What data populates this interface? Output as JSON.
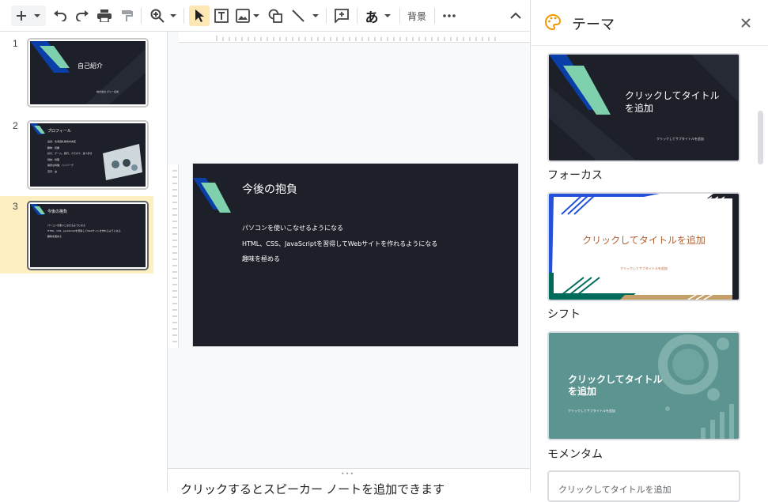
{
  "toolbar": {
    "background_label": "背景",
    "font_char": "あ"
  },
  "filmstrip": {
    "slides": [
      {
        "number": "1",
        "title": "自己紹介",
        "subtitle": "株式会社 ダミー名前"
      },
      {
        "number": "2",
        "title": "プロフィール",
        "lines": [
          "出身：北海道札幌市中央区",
          "趣味：読書",
          "好き：ゲーム、旅行、カラオケ、食べ歩き",
          "特技：料理",
          "得意な料理：ハンバーグ",
          "苦手：虫"
        ]
      },
      {
        "number": "3",
        "title": "今後の抱負",
        "lines": [
          "パソコンを使いこなせるようになる",
          "HTML、CSS、JavaScriptを習得してWebサイトを作れるようになる",
          "趣味を極める"
        ]
      }
    ]
  },
  "canvas": {
    "title": "今後の抱負",
    "lines": [
      "パソコンを使いこなせるようになる",
      "HTML、CSS、JavaScriptを習得してWebサイトを作れるようになる",
      "趣味を極める"
    ]
  },
  "notes": {
    "placeholder": "クリックするとスピーカー ノートを追加できます"
  },
  "themes": {
    "title": "テーマ",
    "items": [
      {
        "name": "フォーカス",
        "title": "クリックしてタイトルを追加",
        "subtitle": "クリックしてサブタイトルを追加"
      },
      {
        "name": "シフト",
        "title": "クリックしてタイトルを追加",
        "subtitle": "クリックしてサブタイトルを追加"
      },
      {
        "name": "モメンタム",
        "title": "クリックしてタイトルを追加",
        "subtitle": "クリックしてサブタイトルを追加"
      },
      {
        "name": "",
        "title": "クリックしてタイトルを追加",
        "subtitle": ""
      }
    ]
  },
  "colors": {
    "slide_bg": "#1d2029",
    "accent_green": "#7fd1ae",
    "accent_blue": "#0b3fa8",
    "selected_slide_bg": "#feefc3",
    "momentum_teal": "#5b9490",
    "shift_tan": "#c6a06a"
  }
}
